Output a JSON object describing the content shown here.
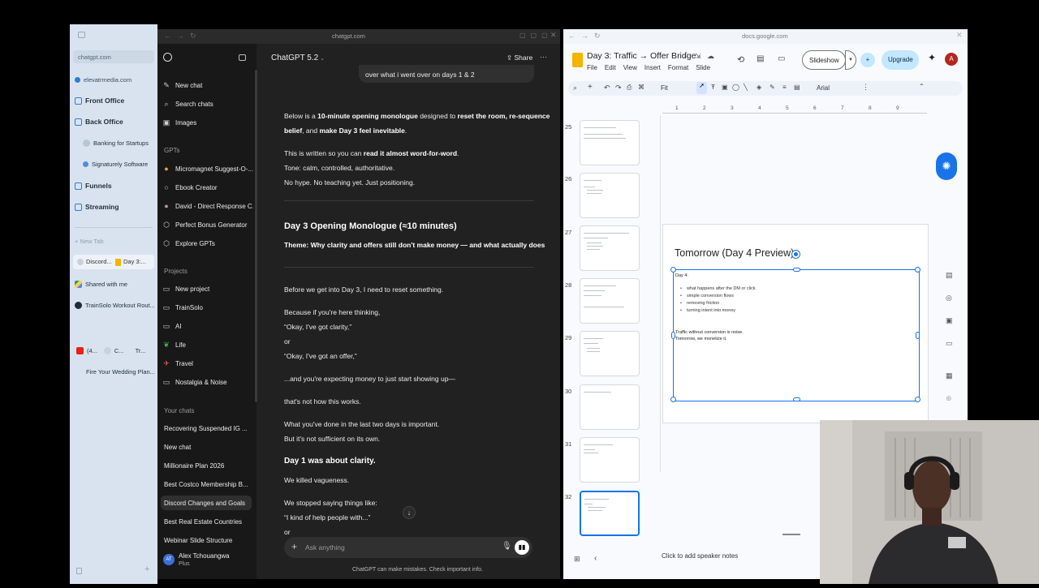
{
  "tab_sidebar": {
    "address": "chatgpt.com",
    "items": [
      {
        "label": "elevatrmedia.com",
        "color": "#2e7bd6"
      },
      {
        "label": "Front Office",
        "color": "#2e7bd6"
      },
      {
        "label": "Back Office",
        "color": "#2e7bd6"
      },
      {
        "label": "Banking for Startups",
        "color": "#9fb3c8"
      },
      {
        "label": "Signaturely Software",
        "color": "#4a90d9"
      },
      {
        "label": "Funnels",
        "color": "#2e7bd6"
      },
      {
        "label": "Streaming",
        "color": "#2e7bd6"
      }
    ],
    "new_tab": "+ New Tab",
    "split_tab_a": "Discord...",
    "split_tab_b": "Day 3:...",
    "shared": "Shared with me",
    "trainsolo": "TrainSolo Workout Rout...",
    "yt_count": "(4...",
    "yt_c": "C...",
    "yt_tr": "Tr...",
    "wedding": "Fire Your Wedding Plan..."
  },
  "chatgpt": {
    "url": "chatgpt.com",
    "model": "ChatGPT 5.2",
    "share": "Share",
    "sidebar": {
      "new_chat": "New chat",
      "search": "Search chats",
      "images": "Images",
      "gpts_heading": "GPTs",
      "gpts": [
        "Micromagnet Suggest-O-...",
        "Ebook Creator",
        "David - Direct Response C...",
        "Perfect Bonus Generator",
        "Explore GPTs"
      ],
      "projects_heading": "Projects",
      "projects": [
        "New project",
        "TrainSolo",
        "AI",
        "Life",
        "Travel",
        "Nostalgia & Noise"
      ],
      "chats_heading": "Your chats",
      "chats": [
        "Recovering Suspended IG ...",
        "New chat",
        "Millionaire Plan 2026",
        "Best Costco Membership B...",
        "Discord Changes and Goals",
        "Best Real Estate Countries",
        "Webinar Slide Structure"
      ],
      "user_name": "Alex Tchouangwa",
      "user_plan": "Plus",
      "avatar": "AT"
    },
    "user_bubble": "over what i went over on days 1 & 2",
    "intro": {
      "p1_a": "Below is a ",
      "p1_b": "10-minute opening monologue",
      "p1_c": " designed to ",
      "p1_d": "reset the room, re-sequence",
      "p1_e": "belief",
      "p1_f": ", and ",
      "p1_g": "make Day 3 feel inevitable",
      "p1_h": ".",
      "p2_a": "This is written so you can ",
      "p2_b": "read it almost word-for-word",
      "p2_c": ".",
      "p3": "Tone: calm, controlled, authoritative.",
      "p4": "No hype. No teaching yet. Just positioning."
    },
    "heading": "Day 3 Opening Monologue (≈10 minutes)",
    "theme": "Theme: Why clarity and offers still don't make money — and what actually does",
    "body": [
      "Before we get into Day 3, I need to reset something.",
      "Because if you're here thinking,",
      "“Okay, I've got clarity,”",
      "or",
      "“Okay, I've got an offer,”",
      "...and you're expecting money to just start showing up—",
      "that's not how this works.",
      "What you've done in the last two days is important.",
      "But it's not sufficient on its own."
    ],
    "day1": "Day 1 was about clarity.",
    "killed": "We killed vagueness.",
    "stopped": "We stopped saying things like:",
    "quote": "“I kind of help people with...”",
    "or2": "or",
    "input_placeholder": "Ask anything",
    "disclaimer": "ChatGPT can make mistakes. Check important info."
  },
  "slides": {
    "url": "docs.google.com",
    "title": "Day 3: Traffic → Offer Bridge",
    "menu": [
      "File",
      "Edit",
      "View",
      "Insert",
      "Format",
      "Slide"
    ],
    "slideshow": "Slideshow",
    "upgrade": "Upgrade",
    "avatar": "A",
    "zoom": "Fit",
    "font": "Arial",
    "ruler_nums": [
      "1",
      "2",
      "3",
      "4",
      "5",
      "6",
      "7",
      "8",
      "9"
    ],
    "thumb_nums": [
      "25",
      "26",
      "27",
      "28",
      "29",
      "30",
      "31",
      "32"
    ],
    "slide_title": "Tomorrow (Day 4 Preview)",
    "slide_day": "Day 4:",
    "slide_bullets": [
      "what happens after the DM or click",
      "simple conversion flows",
      "removing friction",
      "turning intent into money"
    ],
    "slide_line1": "Traffic without conversion is noise.",
    "slide_line2": "Tomorrow, we monetize it.",
    "speaker_notes": "Click to add speaker notes"
  },
  "colors": {
    "accent_blue": "#1a73e8",
    "upgrade_bg": "#c2e7ff",
    "slides_yellow": "#f4b400",
    "gemini_blue": "#1a73e8"
  }
}
